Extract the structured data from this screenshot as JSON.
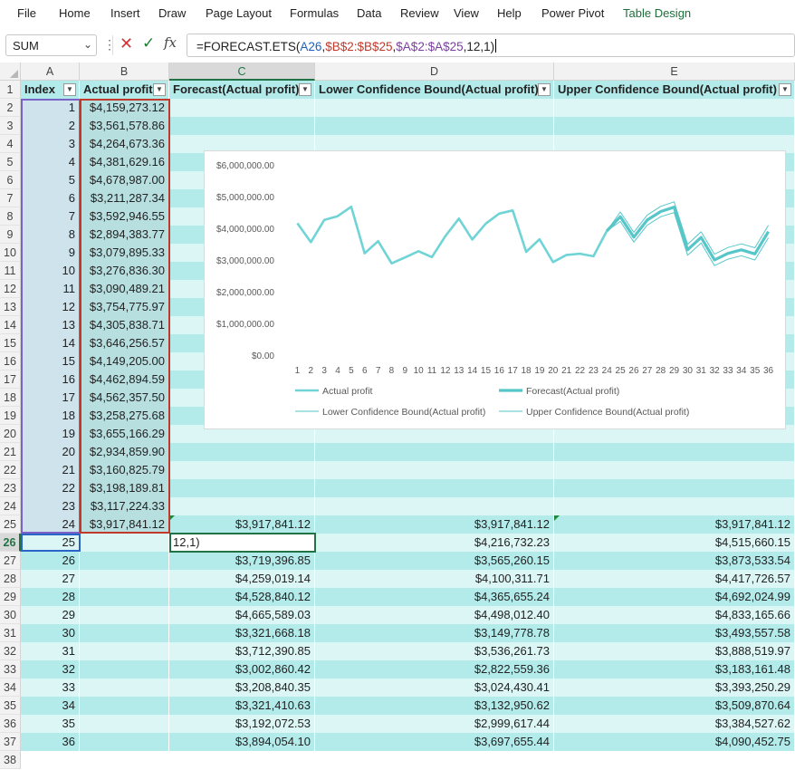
{
  "menu": [
    "File",
    "Home",
    "Insert",
    "Draw",
    "Page Layout",
    "Formulas",
    "Data",
    "Review",
    "View",
    "Help",
    "Power Pivot",
    "Table Design"
  ],
  "name_box": "SUM",
  "formula": {
    "prefix": "=FORECAST.ETS(",
    "a": "A26",
    "c1": ",",
    "b": "$B$2:$B$25",
    "c2": ",",
    "c": "$A$2:$A$25",
    "suffix": ",12,1)"
  },
  "columns": [
    "A",
    "B",
    "C",
    "D",
    "E"
  ],
  "headers": [
    "Index",
    "Actual profit",
    "Forecast(Actual profit)",
    "Lower Confidence Bound(Actual profit)",
    "Upper Confidence Bound(Actual profit)"
  ],
  "rows": [
    [
      "1",
      "$4,159,273.12",
      "",
      "",
      ""
    ],
    [
      "2",
      "$3,561,578.86",
      "",
      "",
      ""
    ],
    [
      "3",
      "$4,264,673.36",
      "",
      "",
      ""
    ],
    [
      "4",
      "$4,381,629.16",
      "",
      "",
      ""
    ],
    [
      "5",
      "$4,678,987.00",
      "",
      "",
      ""
    ],
    [
      "6",
      "$3,211,287.34",
      "",
      "",
      ""
    ],
    [
      "7",
      "$3,592,946.55",
      "",
      "",
      ""
    ],
    [
      "8",
      "$2,894,383.77",
      "",
      "",
      ""
    ],
    [
      "9",
      "$3,079,895.33",
      "",
      "",
      ""
    ],
    [
      "10",
      "$3,276,836.30",
      "",
      "",
      ""
    ],
    [
      "11",
      "$3,090,489.21",
      "",
      "",
      ""
    ],
    [
      "12",
      "$3,754,775.97",
      "",
      "",
      ""
    ],
    [
      "13",
      "$4,305,838.71",
      "",
      "",
      ""
    ],
    [
      "14",
      "$3,646,256.57",
      "",
      "",
      ""
    ],
    [
      "15",
      "$4,149,205.00",
      "",
      "",
      ""
    ],
    [
      "16",
      "$4,462,894.59",
      "",
      "",
      ""
    ],
    [
      "17",
      "$4,562,357.50",
      "",
      "",
      ""
    ],
    [
      "18",
      "$3,258,275.68",
      "",
      "",
      ""
    ],
    [
      "19",
      "$3,655,166.29",
      "",
      "",
      ""
    ],
    [
      "20",
      "$2,934,859.90",
      "",
      "",
      ""
    ],
    [
      "21",
      "$3,160,825.79",
      "",
      "",
      ""
    ],
    [
      "22",
      "$3,198,189.81",
      "",
      "",
      ""
    ],
    [
      "23",
      "$3,117,224.33",
      "",
      "",
      ""
    ],
    [
      "24",
      "$3,917,841.12",
      "$3,917,841.12",
      "$3,917,841.12",
      "$3,917,841.12"
    ],
    [
      "25",
      "",
      "12,1)",
      "$4,216,732.23",
      "$4,515,660.15"
    ],
    [
      "26",
      "",
      "$3,719,396.85",
      "$3,565,260.15",
      "$3,873,533.54"
    ],
    [
      "27",
      "",
      "$4,259,019.14",
      "$4,100,311.71",
      "$4,417,726.57"
    ],
    [
      "28",
      "",
      "$4,528,840.12",
      "$4,365,655.24",
      "$4,692,024.99"
    ],
    [
      "29",
      "",
      "$4,665,589.03",
      "$4,498,012.40",
      "$4,833,165.66"
    ],
    [
      "30",
      "",
      "$3,321,668.18",
      "$3,149,778.78",
      "$3,493,557.58"
    ],
    [
      "31",
      "",
      "$3,712,390.85",
      "$3,536,261.73",
      "$3,888,519.97"
    ],
    [
      "32",
      "",
      "$3,002,860.42",
      "$2,822,559.36",
      "$3,183,161.48"
    ],
    [
      "33",
      "",
      "$3,208,840.35",
      "$3,024,430.41",
      "$3,393,250.29"
    ],
    [
      "34",
      "",
      "$3,321,410.63",
      "$3,132,950.62",
      "$3,509,870.64"
    ],
    [
      "35",
      "",
      "$3,192,072.53",
      "$2,999,617.44",
      "$3,384,527.62"
    ],
    [
      "36",
      "",
      "$3,894,054.10",
      "$3,697,655.44",
      "$4,090,452.75"
    ]
  ],
  "colors": {
    "band_dark": "#b3ebeb",
    "band_light": "#dcf5f5",
    "series": "#70d4d6",
    "accent": "#217346"
  },
  "chart_data": {
    "type": "line",
    "ylim": [
      0,
      6000000
    ],
    "y_ticks": [
      "$6,000,000.00",
      "$5,000,000.00",
      "$4,000,000.00",
      "$3,000,000.00",
      "$2,000,000.00",
      "$1,000,000.00",
      "$0.00"
    ],
    "x": [
      1,
      2,
      3,
      4,
      5,
      6,
      7,
      8,
      9,
      10,
      11,
      12,
      13,
      14,
      15,
      16,
      17,
      18,
      19,
      20,
      21,
      22,
      23,
      24,
      25,
      26,
      27,
      28,
      29,
      30,
      31,
      32,
      33,
      34,
      35,
      36
    ],
    "legend_position": "bottom",
    "series": [
      {
        "name": "Actual profit",
        "values": [
          4159273.12,
          3561578.86,
          4264673.36,
          4381629.16,
          4678987.0,
          3211287.34,
          3592946.55,
          2894383.77,
          3079895.33,
          3276836.3,
          3090489.21,
          3754775.97,
          4305838.71,
          3646256.57,
          4149205.0,
          4462894.59,
          4562357.5,
          3258275.68,
          3655166.29,
          2934859.9,
          3160825.79,
          3198189.81,
          3117224.33,
          3917841.12,
          null,
          null,
          null,
          null,
          null,
          null,
          null,
          null,
          null,
          null,
          null,
          null
        ]
      },
      {
        "name": "Forecast(Actual profit)",
        "values": [
          null,
          null,
          null,
          null,
          null,
          null,
          null,
          null,
          null,
          null,
          null,
          null,
          null,
          null,
          null,
          null,
          null,
          null,
          null,
          null,
          null,
          null,
          null,
          3917841.12,
          4366196.19,
          3719396.85,
          4259019.14,
          4528840.12,
          4665589.03,
          3321668.18,
          3712390.85,
          3002860.42,
          3208840.35,
          3321410.63,
          3192072.53,
          3894054.1
        ]
      },
      {
        "name": "Lower Confidence Bound(Actual profit)",
        "values": [
          null,
          null,
          null,
          null,
          null,
          null,
          null,
          null,
          null,
          null,
          null,
          null,
          null,
          null,
          null,
          null,
          null,
          null,
          null,
          null,
          null,
          null,
          null,
          3917841.12,
          4216732.23,
          3565260.15,
          4100311.71,
          4365655.24,
          4498012.4,
          3149778.78,
          3536261.73,
          2822559.36,
          3024430.41,
          3132950.62,
          2999617.44,
          3697655.44
        ]
      },
      {
        "name": "Upper Confidence Bound(Actual profit)",
        "values": [
          null,
          null,
          null,
          null,
          null,
          null,
          null,
          null,
          null,
          null,
          null,
          null,
          null,
          null,
          null,
          null,
          null,
          null,
          null,
          null,
          null,
          null,
          null,
          3917841.12,
          4515660.15,
          3873533.54,
          4417726.57,
          4692024.99,
          4833165.66,
          3493557.58,
          3888519.97,
          3183161.48,
          3393250.29,
          3509870.64,
          3384527.62,
          4090452.75
        ]
      }
    ]
  }
}
